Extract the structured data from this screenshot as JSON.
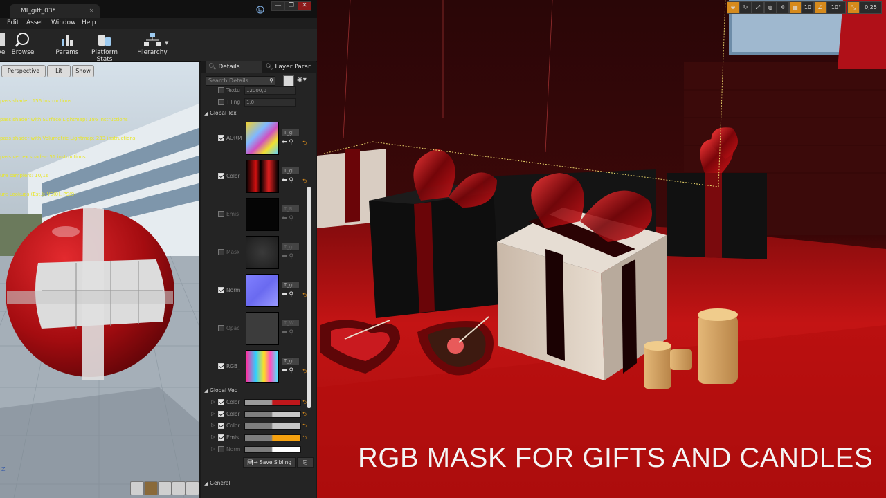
{
  "window": {
    "tab_title": "MI_gift_03*",
    "close_glyph": "×",
    "controls": [
      "—",
      "❐",
      "✕"
    ]
  },
  "menu": [
    "Edit",
    "Asset",
    "Window",
    "Help"
  ],
  "toolbar": [
    {
      "label": "ve",
      "icon": "save-icon"
    },
    {
      "label": "Browse",
      "icon": "browse-icon"
    },
    {
      "label": "Params",
      "icon": "params-icon"
    },
    {
      "label": "Platform Stats",
      "icon": "platform-stats-icon"
    },
    {
      "label": "Hierarchy",
      "icon": "hierarchy-icon"
    }
  ],
  "viewport": {
    "buttons": [
      "Perspective",
      "Lit",
      "Show"
    ],
    "stats": [
      "pass shader: 156 instructions",
      "pass shader with Surface Lightmap: 186 instructions",
      "pass shader with Volumetric Lightmap: 233 instructions",
      "pass vertex shader: 51 instructions",
      "ure samplers: 10/16",
      "ure Lookups (Est.): VS(0), PS(9)"
    ],
    "axis_label": "Z"
  },
  "details": {
    "tabs": [
      "Details",
      "Layer Parar"
    ],
    "search_placeholder": "Search Details",
    "scalar_params": [
      {
        "label": "Textu",
        "value": "12000,0"
      },
      {
        "label": "Tiling",
        "value": "1,0"
      }
    ],
    "section_textures": "Global Tex",
    "textures": [
      {
        "label": "AORM",
        "enabled": true,
        "asset": "T_gi"
      },
      {
        "label": "Color",
        "enabled": true,
        "asset": "T_gi"
      },
      {
        "label": "Emis",
        "enabled": false,
        "asset": "T_Bl"
      },
      {
        "label": "Mask",
        "enabled": false,
        "asset": "T_gi"
      },
      {
        "label": "Norm",
        "enabled": true,
        "asset": "T_gi"
      },
      {
        "label": "Opac",
        "enabled": false,
        "asset": "T_W"
      },
      {
        "label": "RGB_",
        "enabled": true,
        "asset": "T_gi"
      }
    ],
    "section_vectors": "Global Vec",
    "vectors": [
      {
        "label": "Color",
        "enabled": true,
        "color": "#c0171b"
      },
      {
        "label": "Color",
        "enabled": true,
        "color": "#c8c8c8"
      },
      {
        "label": "Color",
        "enabled": true,
        "color": "#c8c8c8"
      },
      {
        "label": "Emis",
        "enabled": true,
        "color": "#f5a10f"
      },
      {
        "label": "Norm",
        "enabled": false,
        "color": "#ffffff"
      }
    ],
    "save_sibling": "Save Sibling",
    "section_general": "General"
  },
  "scene_toolbar": [
    "10°",
    "0,25"
  ],
  "caption": "RGB MASK FOR GIFTS AND CANDLES",
  "colors": {
    "accent_orange": "#d68a1c",
    "gift_red": "#b10e12"
  }
}
